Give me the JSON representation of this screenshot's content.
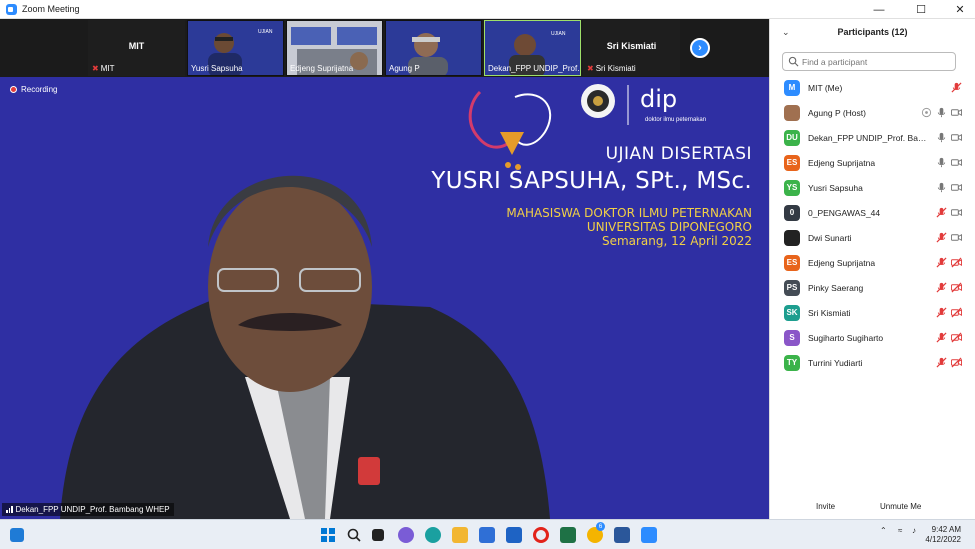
{
  "window": {
    "title": "Zoom Meeting"
  },
  "thumbnails": [
    {
      "name": "MIT",
      "label": "MIT",
      "muted": true,
      "video": false
    },
    {
      "label": "Yusri Sapsuha",
      "muted": false,
      "video": true
    },
    {
      "label": "Edjeng Suprijatna",
      "muted": false,
      "video": true
    },
    {
      "label": "Agung P",
      "muted": false,
      "video": true
    },
    {
      "label": "Dekan_FPP UNDIP_Prof. ...",
      "muted": false,
      "video": true,
      "active": true
    },
    {
      "name": "Sri Kismiati",
      "label": "Sri Kismiati",
      "muted": true,
      "video": false
    }
  ],
  "recording_label": "Recording",
  "slide": {
    "title": "UJIAN DISERTASI",
    "candidate": "YUSRI SAPSUHA, SPt., MSc.",
    "line1": "MAHASISWA DOKTOR ILMU PETERNAKAN",
    "line2": "UNIVERSITAS DIPONEGORO",
    "date": "Semarang, 12 April 2022",
    "brand": "doktor ilmu peternakan"
  },
  "speaker_label": "Dekan_FPP UNDIP_Prof. Bambang WHEP",
  "participants_panel": {
    "title": "Participants (12)",
    "search_placeholder": "Find a participant",
    "invite_label": "Invite",
    "unmute_label": "Unmute Me",
    "participants": [
      {
        "initials": "M",
        "name": "MIT (Me)",
        "color": "#2d8cff",
        "mic": "off",
        "video": "none"
      },
      {
        "initials": "",
        "name": "Agung P (Host)",
        "color": "#a07050",
        "mic": "on",
        "video": "on",
        "share": true
      },
      {
        "initials": "DU",
        "name": "Dekan_FPP UNDIP_Prof. Bamban...",
        "color": "#3bb34a",
        "mic": "on",
        "video": "on"
      },
      {
        "initials": "ES",
        "name": "Edjeng Suprijatna",
        "color": "#e8641b",
        "mic": "on",
        "video": "on"
      },
      {
        "initials": "YS",
        "name": "Yusri Sapsuha",
        "color": "#3bb34a",
        "mic": "on",
        "video": "on"
      },
      {
        "initials": "0",
        "name": "0_PENGAWAS_44",
        "color": "#333a44",
        "mic": "off",
        "video": "on"
      },
      {
        "initials": "",
        "name": "Dwi Sunarti",
        "color": "#222222",
        "mic": "off",
        "video": "on"
      },
      {
        "initials": "ES",
        "name": "Edjeng Suprijatna",
        "color": "#e8641b",
        "mic": "off",
        "video": "off"
      },
      {
        "initials": "PS",
        "name": "Pinky Saerang",
        "color": "#444c55",
        "mic": "off",
        "video": "off"
      },
      {
        "initials": "SK",
        "name": "Sri Kismiati",
        "color": "#1d9e8f",
        "mic": "off",
        "video": "off"
      },
      {
        "initials": "S",
        "name": "Sugiharto Sugiharto",
        "color": "#8a56c8",
        "mic": "off",
        "video": "off"
      },
      {
        "initials": "TY",
        "name": "Turrini Yudiarti",
        "color": "#3bb34a",
        "mic": "off",
        "video": "off"
      }
    ]
  },
  "taskbar": {
    "time": "9:42 AM",
    "date": "4/12/2022",
    "badge": "6",
    "icons": [
      "start-icon",
      "search-icon",
      "file-explorer-icon",
      "chat-icon",
      "edge-icon",
      "folder-icon",
      "mail-icon",
      "opera-icon",
      "excel-icon",
      "chrome-icon",
      "word-icon",
      "zoom-icon"
    ]
  },
  "colors": {
    "accent": "#2d8cff",
    "slide_bg": "#2f2fa3",
    "slide_yellow": "#f2d046",
    "muted_red": "#e23b3b"
  }
}
